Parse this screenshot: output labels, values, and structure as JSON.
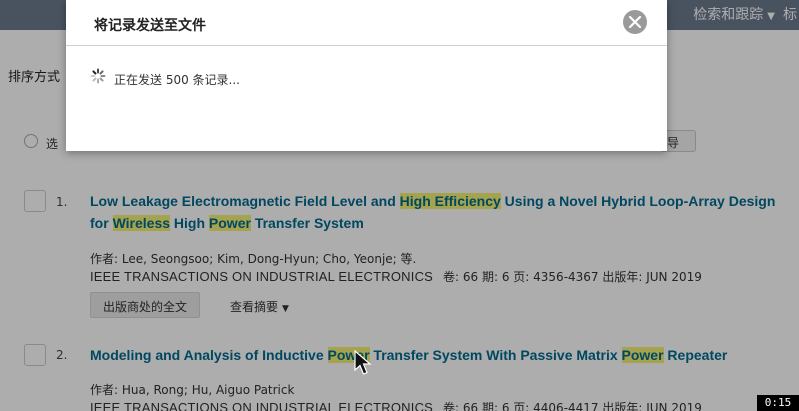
{
  "topbar": {
    "nav_label": "检索和跟踪",
    "extra_label": "标"
  },
  "sortbar": {
    "label": "排序方式"
  },
  "selectbar": {
    "label": "选",
    "right_button": "导"
  },
  "results": [
    {
      "num": "1.",
      "title_parts": [
        {
          "text": "Low Leakage Electromagnetic Field Level and ",
          "hl": false
        },
        {
          "text": "High Efficiency",
          "hl": true
        },
        {
          "text": " Using a Novel Hybrid Loop-Array Design for ",
          "hl": false
        },
        {
          "text": "Wireless",
          "hl": true
        },
        {
          "text": " High ",
          "hl": false
        },
        {
          "text": "Power",
          "hl": true
        },
        {
          "text": " Transfer System",
          "hl": false
        }
      ],
      "authors": "作者: Lee, Seongsoo; Kim, Dong-Hyun; Cho, Yeonje; 等.",
      "journal": "IEEE TRANSACTIONS ON INDUSTRIAL ELECTRONICS",
      "meta": "卷: 66  期: 6  页: 4356-4367  出版年: JUN 2019",
      "fulltext_label": "出版商处的全文",
      "abstract_label": "查看摘要"
    },
    {
      "num": "2.",
      "title_parts": [
        {
          "text": "Modeling and Analysis of Inductive ",
          "hl": false
        },
        {
          "text": "Power",
          "hl": true
        },
        {
          "text": " Transfer System With Passive Matrix ",
          "hl": false
        },
        {
          "text": "Power",
          "hl": true
        },
        {
          "text": " Repeater",
          "hl": false
        }
      ],
      "authors": "作者: Hua, Rong; Hu, Aiguo Patrick",
      "journal": "IEEE TRANSACTIONS ON INDUSTRIAL ELECTRONICS",
      "meta": "卷: 66  期: 6  页: 4406-4417  出版年: JUN 2019"
    }
  ],
  "modal": {
    "title": "将记录发送至文件",
    "status": "正在发送 500 条记录..."
  },
  "timer": "0:15",
  "colors": {
    "topbar": "#6c7a8d",
    "title_link": "#006a8e",
    "highlight": "#f4f074"
  }
}
